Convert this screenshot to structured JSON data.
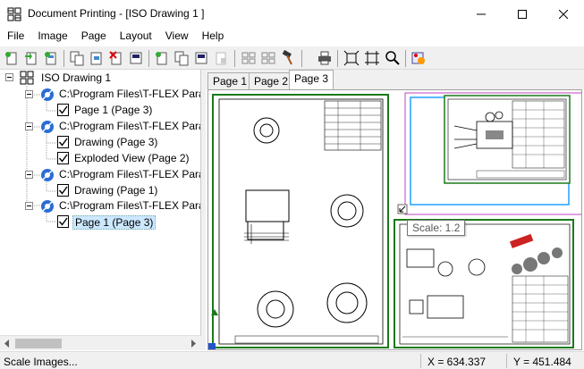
{
  "window": {
    "title": "Document Printing - [ISO Drawing 1 ]"
  },
  "menu": [
    "File",
    "Image",
    "Page",
    "Layout",
    "View",
    "Help"
  ],
  "toolbar_icons": [
    "new-page-icon",
    "import-page-icon",
    "add-page-icon",
    "copy-page-icon",
    "paste-page-icon",
    "delete-page-icon",
    "page-properties-icon",
    "new-document-icon",
    "copy-document-icon",
    "document-settings-icon",
    "disabled-document-icon",
    "arrange-grid-icon",
    "arrange-grid-2-icon",
    "hammer-icon",
    "print-icon",
    "fit-width-icon",
    "fit-height-icon",
    "zoom-icon",
    "settings-wizard-icon"
  ],
  "tree": {
    "root": "ISO Drawing 1",
    "items": [
      {
        "label": "C:\\Program Files\\T-FLEX Para",
        "level": 1,
        "type": "file"
      },
      {
        "label": "Page 1 (Page 3)",
        "level": 2,
        "type": "page"
      },
      {
        "label": "C:\\Program Files\\T-FLEX Para",
        "level": 1,
        "type": "file"
      },
      {
        "label": "Drawing (Page 3)",
        "level": 2,
        "type": "page"
      },
      {
        "label": "Exploded View (Page 2)",
        "level": 2,
        "type": "page"
      },
      {
        "label": "C:\\Program Files\\T-FLEX Para",
        "level": 1,
        "type": "file"
      },
      {
        "label": "Drawing (Page 1)",
        "level": 2,
        "type": "page"
      },
      {
        "label": "C:\\Program Files\\T-FLEX Para",
        "level": 1,
        "type": "file"
      },
      {
        "label": "Page 1 (Page 3)",
        "level": 2,
        "type": "page",
        "selected": true
      }
    ]
  },
  "tabs": [
    "Page 1",
    "Page 2",
    "Page 3"
  ],
  "active_tab": "Page 3",
  "tooltip": "Scale: 1.2",
  "status": {
    "message": "Scale Images...",
    "x": "X = 634.337",
    "y": "Y = 451.484"
  }
}
